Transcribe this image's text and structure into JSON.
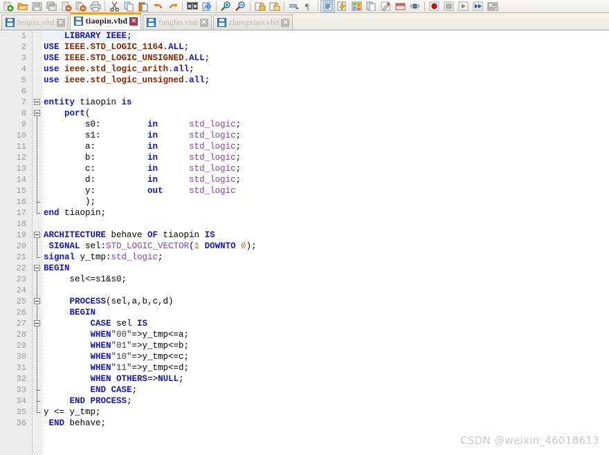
{
  "toolbar": {
    "groups": [
      {
        "items": [
          {
            "name": "new-file-icon",
            "label": "New"
          },
          {
            "name": "open-folder-icon",
            "label": "Open"
          },
          {
            "name": "save-icon",
            "label": "Save"
          },
          {
            "name": "save-all-icon",
            "label": "Save All"
          },
          {
            "name": "close-file-icon",
            "label": "Close"
          },
          {
            "name": "close-all-icon",
            "label": "Close All"
          },
          {
            "name": "print-icon",
            "label": "Print"
          }
        ]
      },
      {
        "items": [
          {
            "name": "cut-icon",
            "label": "Cut"
          },
          {
            "name": "copy-icon",
            "label": "Copy"
          },
          {
            "name": "paste-icon",
            "label": "Paste"
          },
          {
            "name": "undo-icon",
            "label": "Undo"
          },
          {
            "name": "redo-icon",
            "label": "Redo"
          }
        ]
      },
      {
        "items": [
          {
            "name": "find-replace-icon",
            "label": "Find and Replace"
          },
          {
            "name": "goto-line-icon",
            "label": "Go To Line"
          }
        ]
      },
      {
        "items": [
          {
            "name": "zoom-in-icon",
            "label": "Zoom In"
          },
          {
            "name": "zoom-out-icon",
            "label": "Zoom Out"
          }
        ]
      },
      {
        "items": [
          {
            "name": "lock-icon",
            "label": "Lock"
          },
          {
            "name": "unlock-icon",
            "label": "Unlock"
          }
        ]
      },
      {
        "items": [
          {
            "name": "insert-indent-icon",
            "label": "Indent"
          },
          {
            "name": "paragraph-mark-icon",
            "label": "Show Formatting"
          }
        ]
      },
      {
        "items": [
          {
            "name": "synthesis-icon",
            "label": "Synthesize",
            "pressed": true
          },
          {
            "name": "compile-icon",
            "label": "Compile"
          },
          {
            "name": "floorplan-icon",
            "label": "Floorplan"
          },
          {
            "name": "report-icon",
            "label": "Report"
          },
          {
            "name": "settings-pin-icon",
            "label": "Pin Planner"
          },
          {
            "name": "archive-icon",
            "label": "Archive"
          },
          {
            "name": "eye-icon",
            "label": "View"
          }
        ]
      },
      {
        "items": [
          {
            "name": "record-icon",
            "label": "Record"
          },
          {
            "name": "stop-icon",
            "label": "Stop"
          },
          {
            "name": "play-icon",
            "label": "Play"
          },
          {
            "name": "fast-forward-icon",
            "label": "Play All"
          },
          {
            "name": "script-icon",
            "label": "Script"
          }
        ]
      }
    ]
  },
  "tabs": [
    {
      "label": "fenpin.vhd",
      "active": false
    },
    {
      "label": "tiaopin.vhd",
      "active": true
    },
    {
      "label": "fangbo.vhd",
      "active": false
    },
    {
      "label": "zhengxian.vhd",
      "active": false
    }
  ],
  "editor": {
    "language": "VHDL",
    "current_line": 1,
    "lines": [
      {
        "n": 1,
        "tokens": [
          {
            "t": "    ",
            "c": "pl"
          },
          {
            "t": "LIBRARY",
            "c": "kw"
          },
          {
            "t": " ",
            "c": "pl"
          },
          {
            "t": "IEEE",
            "c": "kw"
          },
          {
            "t": ";",
            "c": "pl"
          }
        ]
      },
      {
        "n": 2,
        "tokens": [
          {
            "t": "USE",
            "c": "kw"
          },
          {
            "t": " ",
            "c": "pl"
          },
          {
            "t": "IEEE.STD_LOGIC_1164.",
            "c": "pkg"
          },
          {
            "t": "ALL",
            "c": "kw"
          },
          {
            "t": ";",
            "c": "pl"
          }
        ]
      },
      {
        "n": 3,
        "tokens": [
          {
            "t": "USE",
            "c": "kw"
          },
          {
            "t": " ",
            "c": "pl"
          },
          {
            "t": "IEEE.STD_LOGIC_UNSIGNED.",
            "c": "pkg"
          },
          {
            "t": "ALL",
            "c": "kw"
          },
          {
            "t": ";",
            "c": "pl"
          }
        ]
      },
      {
        "n": 4,
        "tokens": [
          {
            "t": "use",
            "c": "kw"
          },
          {
            "t": " ",
            "c": "pl"
          },
          {
            "t": "ieee.std_logic_arith.",
            "c": "pkg"
          },
          {
            "t": "all",
            "c": "kw"
          },
          {
            "t": ";",
            "c": "pl"
          }
        ]
      },
      {
        "n": 5,
        "tokens": [
          {
            "t": "use",
            "c": "kw"
          },
          {
            "t": " ",
            "c": "pl"
          },
          {
            "t": "ieee.std_logic_unsigned.",
            "c": "pkg"
          },
          {
            "t": "all",
            "c": "kw"
          },
          {
            "t": ";",
            "c": "pl"
          }
        ]
      },
      {
        "n": 6,
        "tokens": []
      },
      {
        "n": 7,
        "tokens": [
          {
            "t": "entity",
            "c": "kw"
          },
          {
            "t": " tiaopin ",
            "c": "pl"
          },
          {
            "t": "is",
            "c": "kw"
          }
        ]
      },
      {
        "n": 8,
        "tokens": [
          {
            "t": "    ",
            "c": "pl"
          },
          {
            "t": "port",
            "c": "kw"
          },
          {
            "t": "(",
            "c": "pl"
          }
        ]
      },
      {
        "n": 9,
        "tokens": [
          {
            "t": "        s0:         ",
            "c": "pl"
          },
          {
            "t": "in",
            "c": "kw"
          },
          {
            "t": "      ",
            "c": "pl"
          },
          {
            "t": "std_logic",
            "c": "typ"
          },
          {
            "t": ";",
            "c": "pl"
          }
        ]
      },
      {
        "n": 10,
        "tokens": [
          {
            "t": "        s1:         ",
            "c": "pl"
          },
          {
            "t": "in",
            "c": "kw"
          },
          {
            "t": "      ",
            "c": "pl"
          },
          {
            "t": "std_logic",
            "c": "typ"
          },
          {
            "t": ";",
            "c": "pl"
          }
        ]
      },
      {
        "n": 11,
        "tokens": [
          {
            "t": "        a:          ",
            "c": "pl"
          },
          {
            "t": "in",
            "c": "kw"
          },
          {
            "t": "      ",
            "c": "pl"
          },
          {
            "t": "std_logic",
            "c": "typ"
          },
          {
            "t": ";",
            "c": "pl"
          }
        ]
      },
      {
        "n": 12,
        "tokens": [
          {
            "t": "        b:          ",
            "c": "pl"
          },
          {
            "t": "in",
            "c": "kw"
          },
          {
            "t": "      ",
            "c": "pl"
          },
          {
            "t": "std_logic",
            "c": "typ"
          },
          {
            "t": ";",
            "c": "pl"
          }
        ]
      },
      {
        "n": 13,
        "tokens": [
          {
            "t": "        c:          ",
            "c": "pl"
          },
          {
            "t": "in",
            "c": "kw"
          },
          {
            "t": "      ",
            "c": "pl"
          },
          {
            "t": "std_logic",
            "c": "typ"
          },
          {
            "t": ";",
            "c": "pl"
          }
        ]
      },
      {
        "n": 14,
        "tokens": [
          {
            "t": "        d:          ",
            "c": "pl"
          },
          {
            "t": "in",
            "c": "kw"
          },
          {
            "t": "      ",
            "c": "pl"
          },
          {
            "t": "std_logic",
            "c": "typ"
          },
          {
            "t": ";",
            "c": "pl"
          }
        ]
      },
      {
        "n": 15,
        "tokens": [
          {
            "t": "        y:          ",
            "c": "pl"
          },
          {
            "t": "out",
            "c": "kw"
          },
          {
            "t": "     ",
            "c": "pl"
          },
          {
            "t": "std_logic",
            "c": "typ"
          }
        ]
      },
      {
        "n": 16,
        "tokens": [
          {
            "t": "        );",
            "c": "pl"
          }
        ]
      },
      {
        "n": 17,
        "tokens": [
          {
            "t": "end",
            "c": "kw"
          },
          {
            "t": " tiaopin;",
            "c": "pl"
          }
        ]
      },
      {
        "n": 18,
        "tokens": []
      },
      {
        "n": 19,
        "tokens": [
          {
            "t": "ARCHITECTURE",
            "c": "kw"
          },
          {
            "t": " behave ",
            "c": "pl"
          },
          {
            "t": "OF",
            "c": "kw"
          },
          {
            "t": " tiaopin ",
            "c": "pl"
          },
          {
            "t": "IS",
            "c": "kw"
          }
        ]
      },
      {
        "n": 20,
        "tokens": [
          {
            "t": " ",
            "c": "pl"
          },
          {
            "t": "SIGNAL",
            "c": "kw"
          },
          {
            "t": " sel:",
            "c": "pl"
          },
          {
            "t": "STD_LOGIC_VECTOR",
            "c": "typ"
          },
          {
            "t": "(",
            "c": "pl"
          },
          {
            "t": "1",
            "c": "num-lit"
          },
          {
            "t": " ",
            "c": "pl"
          },
          {
            "t": "DOWNTO",
            "c": "kw"
          },
          {
            "t": " ",
            "c": "pl"
          },
          {
            "t": "0",
            "c": "num-lit"
          },
          {
            "t": ");",
            "c": "pl"
          }
        ]
      },
      {
        "n": 21,
        "tokens": [
          {
            "t": "signal",
            "c": "kw"
          },
          {
            "t": " y_tmp:",
            "c": "pl"
          },
          {
            "t": "std_logic",
            "c": "typ"
          },
          {
            "t": ";",
            "c": "pl"
          }
        ]
      },
      {
        "n": 22,
        "tokens": [
          {
            "t": "BEGIN",
            "c": "kw"
          }
        ]
      },
      {
        "n": 23,
        "tokens": [
          {
            "t": "     sel<=s1&s0;",
            "c": "pl"
          }
        ]
      },
      {
        "n": 24,
        "tokens": []
      },
      {
        "n": 25,
        "tokens": [
          {
            "t": "     ",
            "c": "pl"
          },
          {
            "t": "PROCESS",
            "c": "kw"
          },
          {
            "t": "(sel,a,b,c,d)",
            "c": "pl"
          }
        ]
      },
      {
        "n": 26,
        "tokens": [
          {
            "t": "     ",
            "c": "pl"
          },
          {
            "t": "BEGIN",
            "c": "kw"
          }
        ]
      },
      {
        "n": 27,
        "tokens": [
          {
            "t": "         ",
            "c": "pl"
          },
          {
            "t": "CASE",
            "c": "kw"
          },
          {
            "t": " sel ",
            "c": "pl"
          },
          {
            "t": "IS",
            "c": "kw"
          }
        ]
      },
      {
        "n": 28,
        "tokens": [
          {
            "t": "         ",
            "c": "pl"
          },
          {
            "t": "WHEN",
            "c": "kw"
          },
          {
            "t": "\"00\"",
            "c": "str"
          },
          {
            "t": "=>y_tmp<=a;",
            "c": "pl"
          }
        ]
      },
      {
        "n": 29,
        "tokens": [
          {
            "t": "         ",
            "c": "pl"
          },
          {
            "t": "WHEN",
            "c": "kw"
          },
          {
            "t": "\"01\"",
            "c": "str"
          },
          {
            "t": "=>y_tmp<=b;",
            "c": "pl"
          }
        ]
      },
      {
        "n": 30,
        "tokens": [
          {
            "t": "         ",
            "c": "pl"
          },
          {
            "t": "WHEN",
            "c": "kw"
          },
          {
            "t": "\"10\"",
            "c": "str"
          },
          {
            "t": "=>y_tmp<=c;",
            "c": "pl"
          }
        ]
      },
      {
        "n": 31,
        "tokens": [
          {
            "t": "         ",
            "c": "pl"
          },
          {
            "t": "WHEN",
            "c": "kw"
          },
          {
            "t": "\"11\"",
            "c": "str"
          },
          {
            "t": "=>y_tmp<=d;",
            "c": "pl"
          }
        ]
      },
      {
        "n": 32,
        "tokens": [
          {
            "t": "         ",
            "c": "pl"
          },
          {
            "t": "WHEN",
            "c": "kw"
          },
          {
            "t": " ",
            "c": "pl"
          },
          {
            "t": "OTHERS",
            "c": "kw"
          },
          {
            "t": "=>",
            "c": "pl"
          },
          {
            "t": "NULL",
            "c": "kw"
          },
          {
            "t": ";",
            "c": "pl"
          }
        ]
      },
      {
        "n": 33,
        "tokens": [
          {
            "t": "         ",
            "c": "pl"
          },
          {
            "t": "END",
            "c": "kw"
          },
          {
            "t": " ",
            "c": "pl"
          },
          {
            "t": "CASE",
            "c": "kw"
          },
          {
            "t": ";",
            "c": "pl"
          }
        ]
      },
      {
        "n": 34,
        "tokens": [
          {
            "t": "     ",
            "c": "pl"
          },
          {
            "t": "END",
            "c": "kw"
          },
          {
            "t": " ",
            "c": "pl"
          },
          {
            "t": "PROCESS",
            "c": "kw"
          },
          {
            "t": ";",
            "c": "pl"
          }
        ]
      },
      {
        "n": 35,
        "tokens": [
          {
            "t": "y <= y_tmp;",
            "c": "pl"
          }
        ]
      },
      {
        "n": 36,
        "tokens": [
          {
            "t": " ",
            "c": "pl"
          },
          {
            "t": "END",
            "c": "kw"
          },
          {
            "t": " behave;",
            "c": "pl"
          }
        ]
      }
    ],
    "folds": [
      {
        "line": 7,
        "type": "box"
      },
      {
        "line": 8,
        "type": "box"
      },
      {
        "line": 19,
        "type": "box"
      },
      {
        "line": 22,
        "type": "box"
      },
      {
        "line": 25,
        "type": "box"
      },
      {
        "line": 27,
        "type": "box"
      }
    ]
  },
  "watermark": "CSDN @weixin_46018613",
  "colors": {
    "keyword": "#1414cf",
    "package": "#8b2500",
    "type": "#8b3fb5",
    "number": "#d2691e",
    "string": "#3a3a3a",
    "plain": "#000000",
    "gutter_bg": "#ececec",
    "line_number": "#9a9a9a",
    "active_tab_accent": "#f59b25",
    "current_line_bg": "#eef2fc",
    "watermark": "#c9c9c9"
  }
}
